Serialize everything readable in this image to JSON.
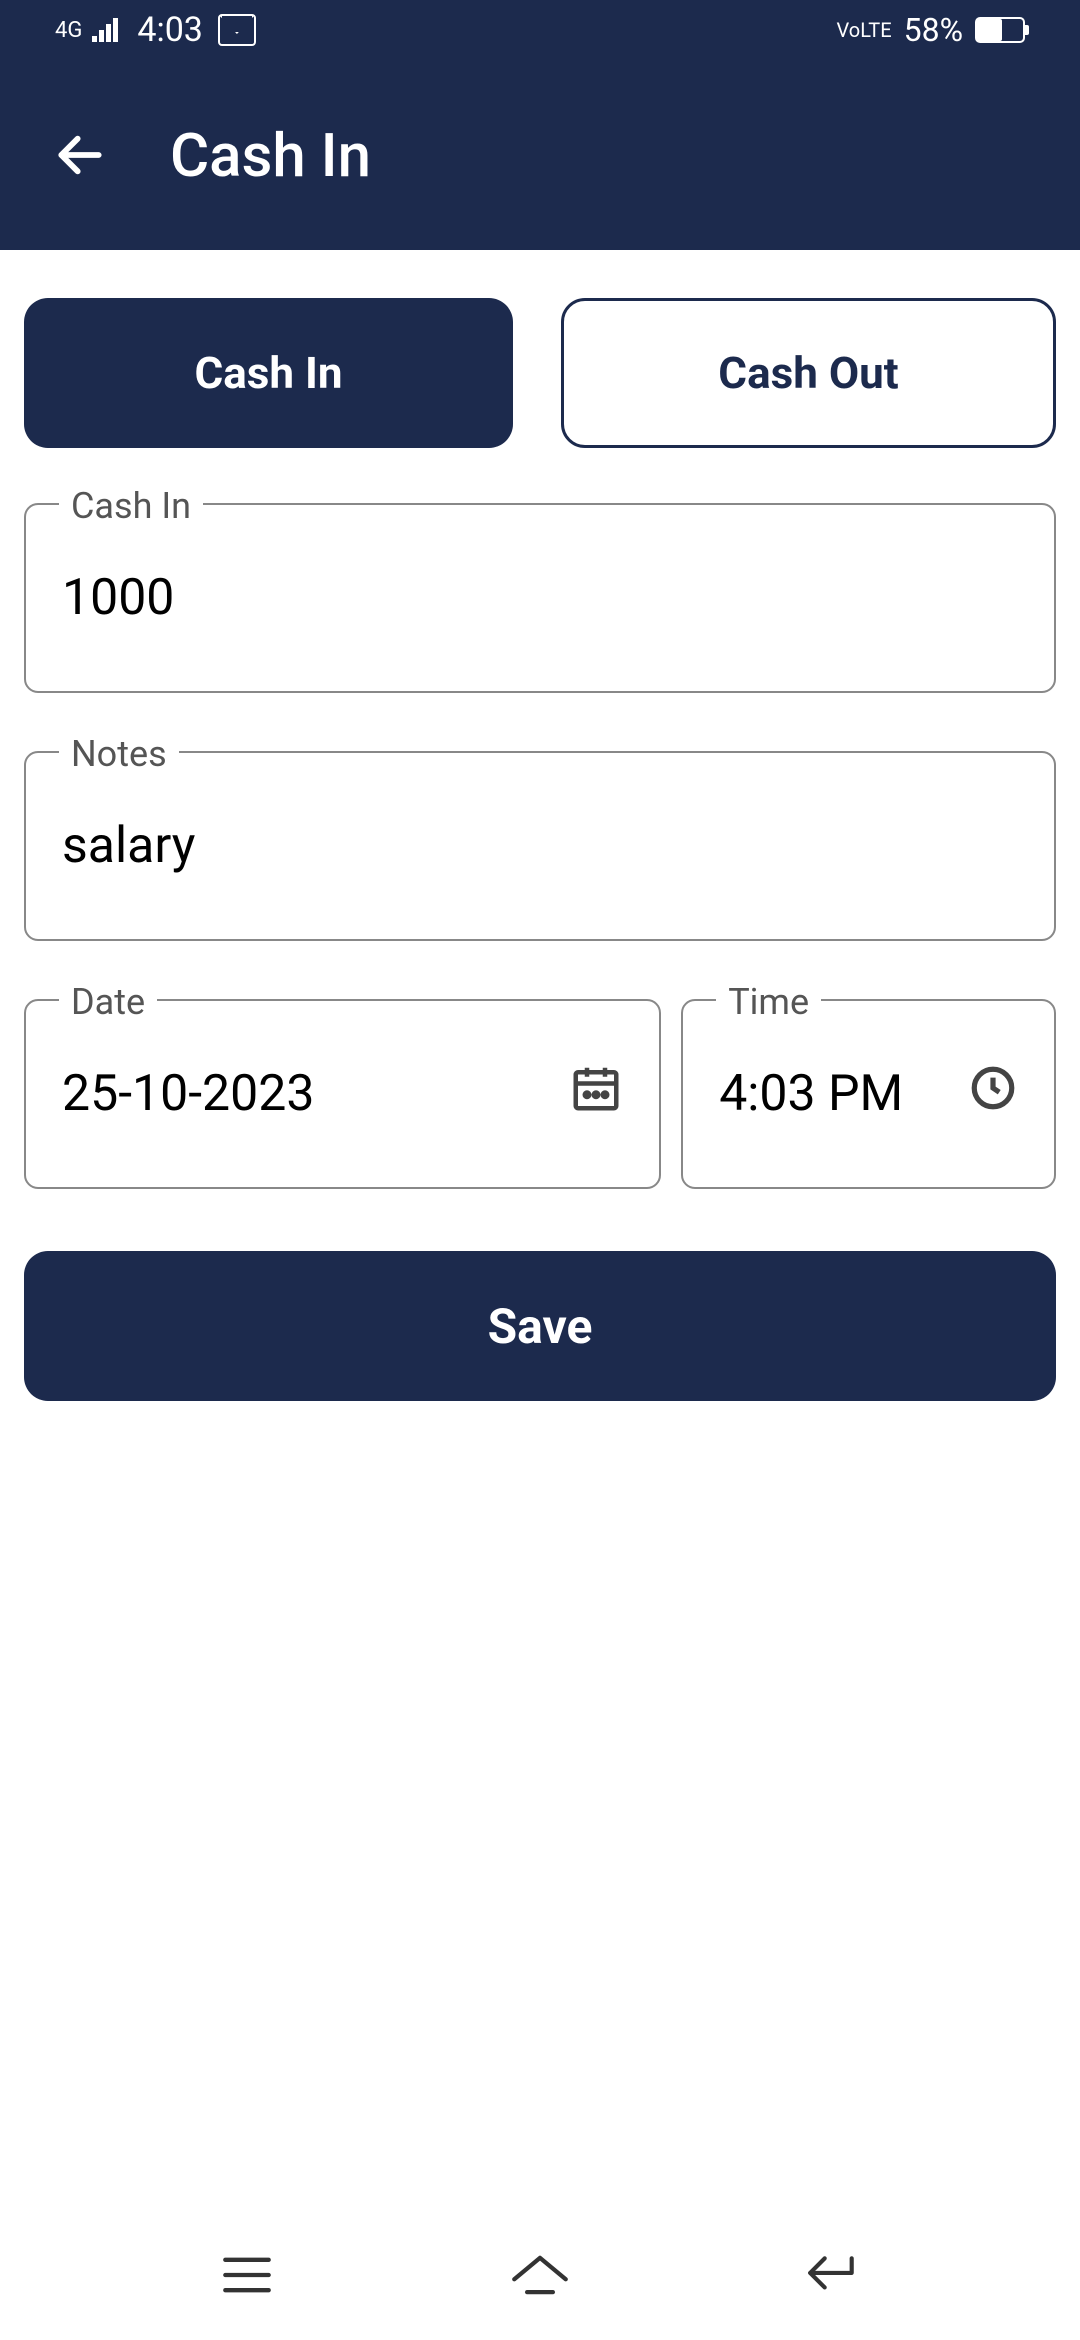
{
  "status_bar": {
    "network": "4G",
    "time": "4:03",
    "volte": "VoLTE",
    "battery_pct": "58%"
  },
  "app_bar": {
    "title": "Cash In"
  },
  "toggle": {
    "cash_in": "Cash In",
    "cash_out": "Cash Out"
  },
  "fields": {
    "amount_label": "Cash In",
    "amount_value": "1000",
    "notes_label": "Notes",
    "notes_value": "salary",
    "date_label": "Date",
    "date_value": "25-10-2023",
    "time_label": "Time",
    "time_value": "4:03 PM"
  },
  "buttons": {
    "save": "Save"
  }
}
